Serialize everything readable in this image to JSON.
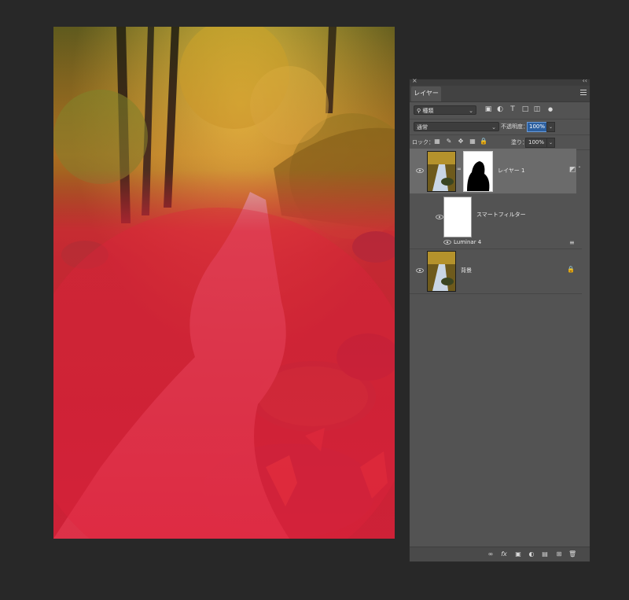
{
  "panel": {
    "close_glyph": "×",
    "collapse_glyph": "‹‹",
    "tab_label": "レイヤー",
    "filter": {
      "kind_label": "種類"
    },
    "blend": {
      "mode": "通常",
      "opacity_label": "不透明度：",
      "opacity_value": "100%"
    },
    "lock": {
      "label": "ロック：",
      "fill_label": "塗り：",
      "fill_value": "100%"
    },
    "layers": [
      {
        "name": "レイヤー 1",
        "selected": true,
        "smart_filter_label": "スマートフィルター",
        "filter_name": "Luminar 4"
      },
      {
        "name": "背景",
        "locked": true
      }
    ],
    "bottom_icons": [
      "link-icon",
      "fx-icon",
      "add-mask-icon",
      "adjustment-icon",
      "group-folder-icon",
      "new-layer-icon",
      "trash-icon"
    ],
    "fx_label": "fx"
  },
  "colors": {
    "overlay_red": "#e0223c",
    "panel_bg": "#535353",
    "app_bg": "#282828",
    "highlight": "#2b5fa0"
  }
}
